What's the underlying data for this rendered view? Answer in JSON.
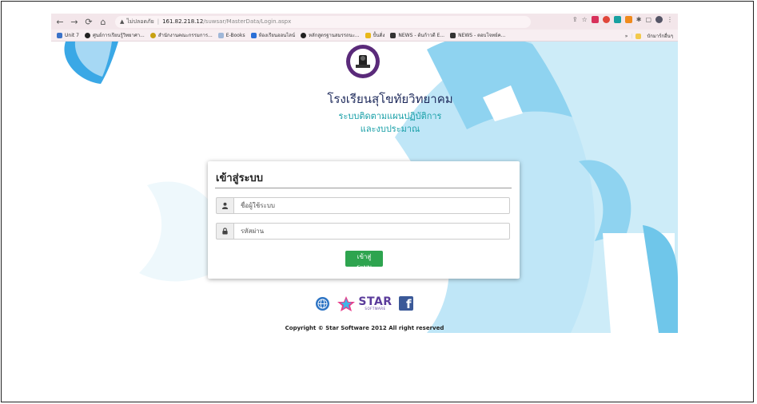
{
  "browser": {
    "security_label": "ไม่ปลอดภัย",
    "url_host": "161.82.218.12",
    "url_path": "/suwsar/MasterData/Login.aspx"
  },
  "bookmarks": {
    "items": [
      {
        "label": "Unit 7",
        "color": "#3b73c8"
      },
      {
        "label": "ศูนย์การเรียนรู้วิทยาศา...",
        "color": "#222222"
      },
      {
        "label": "สำนักงานคณะกรรมการ...",
        "color": "#c7a112"
      },
      {
        "label": "E-Books",
        "color": "#9fb7d8"
      },
      {
        "label": "ห้องเรียนออนไลน์",
        "color": "#2a6fd6"
      },
      {
        "label": "หลักสูตรฐานสมรรถนะ...",
        "color": "#222222"
      },
      {
        "label": "ปั้นติ่ง",
        "color": "#e8b81a"
      },
      {
        "label": "NEWS - ต้นก้าวดี E...",
        "color": "#333333"
      },
      {
        "label": "NEWS - ตอบโจทย์ค...",
        "color": "#333333"
      }
    ],
    "more_label": "»",
    "folder_label": "บักมาร์กอื่นๆ"
  },
  "page": {
    "school_name": "โรงเรียนสุโขทัยวิทยาคม",
    "subtitle_line1": "ระบบติดตามแผนปฏิบัติการ",
    "subtitle_line2": "และงบประมาณ",
    "login_card": {
      "title": "เข้าสู่ระบบ",
      "username_placeholder": "ชื่อผู้ใช้ระบบ",
      "password_placeholder": "รหัสผ่าน",
      "submit_label": "เข้าสู่ระบบ"
    },
    "star_logo_big": "STAR",
    "star_logo_small": "SOFTWARE",
    "facebook_letter": "f",
    "copyright": "Copyright © Star Software 2012 All right reserved"
  },
  "colors": {
    "accent_green": "#2ea44f",
    "subtitle_teal": "#1aa0a8",
    "decor_blue": "#8fd3f0"
  }
}
